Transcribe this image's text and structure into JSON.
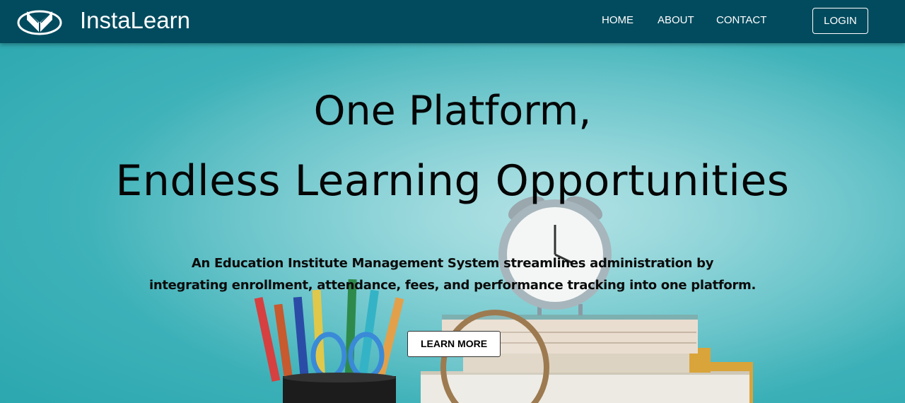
{
  "navbar": {
    "brand": "InstaLearn",
    "logo_icon": "book-logo-icon",
    "links": [
      "HOME",
      "ABOUT",
      "CONTACT"
    ],
    "login_label": "LOGIN"
  },
  "hero": {
    "title_line_1": "One Platform,",
    "title_line_2": "Endless Learning Opportunities",
    "subtitle_line_1": "An Education Institute Management System streamlines administration by",
    "subtitle_line_2": "integrating enrollment, attendance, fees, and performance tracking into one platform.",
    "cta_label": "LEARN MORE",
    "background": "teal-education-illustration"
  },
  "colors": {
    "navbar_bg": "#024b5e",
    "hero_bg": "#3fb2b9",
    "text_dark": "#050505",
    "button_bg": "#ffffff"
  }
}
